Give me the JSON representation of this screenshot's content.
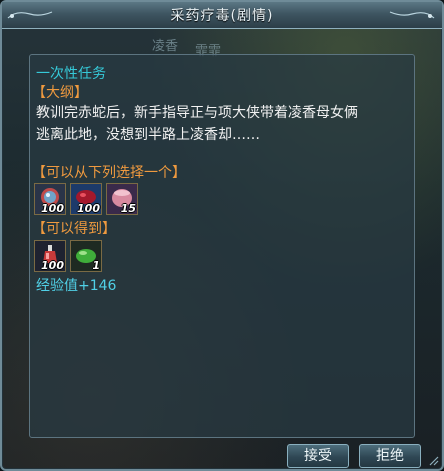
{
  "window": {
    "title": "采药疗毒(剧情)"
  },
  "background_names": [
    "凌香",
    "霏霏"
  ],
  "quest": {
    "type_label": "一次性任务",
    "outline_header": "【大纲】",
    "description_lines": [
      "教训完赤蛇后，新手指导正与项大侠带着凌香母女俩",
      "逃离此地，没想到半路上凌香却……"
    ],
    "choose_header": "【可以从下列选择一个】",
    "choice_items": [
      {
        "icon": "orb-icon",
        "qty": "100"
      },
      {
        "icon": "red-potion-icon",
        "qty": "100"
      },
      {
        "icon": "pink-bag-icon",
        "qty": "15"
      }
    ],
    "receive_header": "【可以得到】",
    "reward_items": [
      {
        "icon": "vial-icon",
        "qty": "100"
      },
      {
        "icon": "green-herb-icon",
        "qty": "1"
      }
    ],
    "exp_label": "经验值+146"
  },
  "buttons": {
    "accept": "接受",
    "decline": "拒绝"
  },
  "colors": {
    "type_label": "#36c9d8",
    "headers": "#ef9a3f",
    "text": "#f2f2f2",
    "exp": "#50d0e6"
  }
}
